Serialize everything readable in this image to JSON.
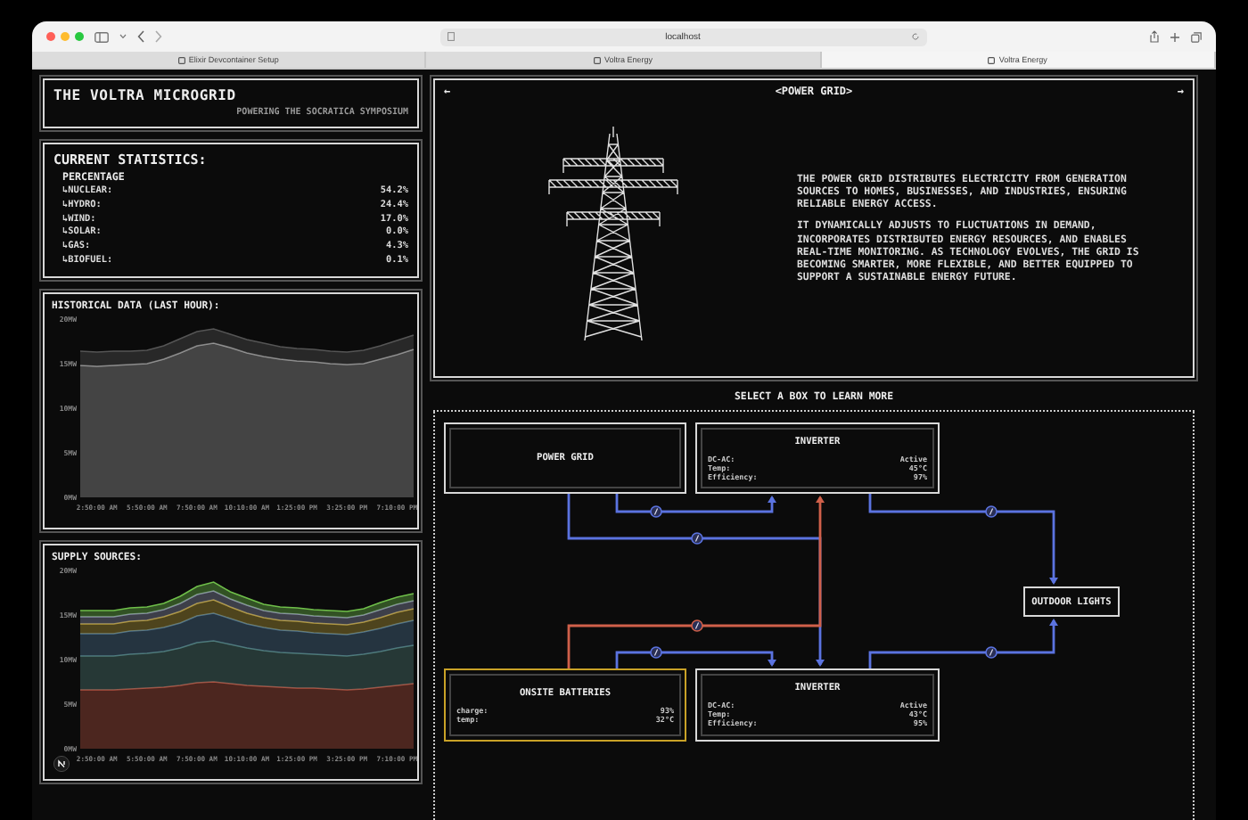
{
  "browser": {
    "address": "localhost",
    "tabs": [
      {
        "label": "Elixir Devcontainer Setup",
        "selected": false
      },
      {
        "label": "Voltra Energy",
        "selected": false
      },
      {
        "label": "Voltra Energy",
        "selected": true
      }
    ]
  },
  "header": {
    "title": "THE VOLTRA MICROGRID",
    "subtitle": "POWERING THE SOCRATICA SYMPOSIUM"
  },
  "statistics": {
    "title": "CURRENT STATISTICS:",
    "heading": "PERCENTAGE",
    "rows": [
      {
        "label": "↳NUCLEAR:",
        "value": "54.2%"
      },
      {
        "label": "↳HYDRO:",
        "value": "24.4%"
      },
      {
        "label": "↳WIND:",
        "value": "17.0%"
      },
      {
        "label": "↳SOLAR:",
        "value": "0.0%"
      },
      {
        "label": "↳GAS:",
        "value": "4.3%"
      },
      {
        "label": "↳BIOFUEL:",
        "value": "0.1%"
      }
    ]
  },
  "historical": {
    "title": "HISTORICAL DATA (LAST HOUR):",
    "chart_data": {
      "type": "area",
      "stacked": true,
      "categories": [
        null,
        "2:50:00 AM",
        null,
        null,
        "5:50:00 AM",
        null,
        null,
        "7:50:00 AM",
        null,
        null,
        "10:10:00 AM",
        null,
        null,
        "1:25:00 PM",
        null,
        null,
        "3:25:00 PM",
        null,
        null,
        "7:10:00 PM",
        null
      ],
      "ylim": [
        0,
        20
      ],
      "yticks": [
        {
          "value": 0,
          "label": "0MW"
        },
        {
          "value": 5,
          "label": "5MW"
        },
        {
          "value": 10,
          "label": "10MW"
        },
        {
          "value": 15,
          "label": "15MW"
        },
        {
          "value": 20,
          "label": "20MW"
        }
      ],
      "series": [
        {
          "color": "#9a9a9a",
          "values": [
            14.8,
            14.7,
            14.8,
            14.9,
            15.0,
            15.5,
            16.2,
            17.0,
            17.3,
            16.8,
            16.2,
            15.8,
            15.5,
            15.3,
            15.2,
            15.0,
            14.9,
            15.0,
            15.5,
            16.0,
            16.6
          ]
        },
        {
          "color": "#555555",
          "values": [
            1.6,
            1.6,
            1.6,
            1.5,
            1.5,
            1.5,
            1.6,
            1.6,
            1.6,
            1.5,
            1.5,
            1.5,
            1.4,
            1.4,
            1.4,
            1.4,
            1.4,
            1.5,
            1.5,
            1.6,
            1.6
          ]
        }
      ]
    }
  },
  "supply": {
    "title": "SUPPLY SOURCES:",
    "chart_data": {
      "type": "area",
      "stacked": true,
      "categories": [
        null,
        "2:50:00 AM",
        null,
        null,
        "5:50:00 AM",
        null,
        null,
        "7:50:00 AM",
        null,
        null,
        "10:10:00 AM",
        null,
        null,
        "1:25:00 PM",
        null,
        null,
        "3:25:00 PM",
        null,
        null,
        "7:10:00 PM",
        null
      ],
      "ylim": [
        0,
        20
      ],
      "yticks": [
        {
          "value": 0,
          "label": "0MW"
        },
        {
          "value": 5,
          "label": "5MW"
        },
        {
          "value": 10,
          "label": "10MW"
        },
        {
          "value": 15,
          "label": "15MW"
        },
        {
          "value": 20,
          "label": "20MW"
        }
      ],
      "series": [
        {
          "color": "#b0503f",
          "values": [
            6.6,
            6.6,
            6.6,
            6.7,
            6.8,
            6.9,
            7.1,
            7.4,
            7.5,
            7.3,
            7.1,
            7.0,
            6.9,
            6.8,
            6.8,
            6.7,
            6.6,
            6.7,
            6.9,
            7.1,
            7.3
          ]
        },
        {
          "color": "#4f7c78",
          "values": [
            3.8,
            3.8,
            3.8,
            3.9,
            3.9,
            4.0,
            4.2,
            4.5,
            4.6,
            4.4,
            4.2,
            4.0,
            3.9,
            3.9,
            3.8,
            3.8,
            3.8,
            3.9,
            4.0,
            4.2,
            4.3
          ]
        },
        {
          "color": "#4d7390",
          "values": [
            2.5,
            2.5,
            2.5,
            2.6,
            2.6,
            2.7,
            2.8,
            3.0,
            3.1,
            2.9,
            2.7,
            2.6,
            2.5,
            2.5,
            2.4,
            2.4,
            2.4,
            2.5,
            2.6,
            2.7,
            2.8
          ]
        },
        {
          "color": "#b59a3a",
          "values": [
            1.1,
            1.1,
            1.1,
            1.1,
            1.1,
            1.2,
            1.3,
            1.4,
            1.5,
            1.3,
            1.2,
            1.1,
            1.1,
            1.1,
            1.1,
            1.1,
            1.1,
            1.1,
            1.2,
            1.3,
            1.3
          ]
        },
        {
          "color": "#8a8fa8",
          "values": [
            0.8,
            0.8,
            0.8,
            0.8,
            0.8,
            0.8,
            0.9,
            1.0,
            1.0,
            0.9,
            0.9,
            0.8,
            0.8,
            0.8,
            0.8,
            0.8,
            0.8,
            0.8,
            0.9,
            0.9,
            0.9
          ]
        },
        {
          "color": "#6fbf4a",
          "values": [
            0.7,
            0.7,
            0.7,
            0.7,
            0.7,
            0.7,
            0.8,
            0.9,
            1.0,
            0.8,
            0.8,
            0.7,
            0.7,
            0.7,
            0.7,
            0.7,
            0.7,
            0.7,
            0.8,
            0.8,
            0.8
          ]
        }
      ]
    }
  },
  "info": {
    "prev": "←",
    "next": "→",
    "title": "<POWER GRID>",
    "paragraphs": [
      "THE POWER GRID DISTRIBUTES ELECTRICITY FROM GENERATION SOURCES TO HOMES, BUSINESSES, AND INDUSTRIES, ENSURING RELIABLE ENERGY ACCESS.",
      "IT DYNAMICALLY ADJUSTS TO FLUCTUATIONS IN DEMAND, INCORPORATES DISTRIBUTED ENERGY RESOURCES, AND ENABLES REAL-TIME MONITORING. AS TECHNOLOGY EVOLVES, THE GRID IS BECOMING SMARTER, MORE FLEXIBLE, AND BETTER EQUIPPED TO SUPPORT A SUSTAINABLE ENERGY FUTURE."
    ]
  },
  "diagram": {
    "prompt": "SELECT A BOX TO LEARN MORE",
    "nodes": [
      {
        "kind": "box",
        "title": "POWER GRID",
        "color": "#d8d8d8"
      },
      {
        "kind": "box",
        "title": "INVERTER",
        "color": "#d8d8d8",
        "fields": [
          {
            "label": "DC-AC:",
            "value": "Active"
          },
          {
            "label": "Temp:",
            "value": "45°C"
          },
          {
            "label": "Efficiency:",
            "value": "97%"
          }
        ]
      },
      {
        "kind": "tag",
        "title": "OUTDOOR LIGHTS",
        "color": "#d8d8d8"
      },
      {
        "kind": "box",
        "title": "ONSITE BATTERIES",
        "color": "#c9a227",
        "fields": [
          {
            "label": "charge:",
            "value": "93%"
          },
          {
            "label": "temp:",
            "value": "32°C"
          }
        ]
      },
      {
        "kind": "box",
        "title": "INVERTER",
        "color": "#d8d8d8",
        "fields": [
          {
            "label": "DC-AC:",
            "value": "Active"
          },
          {
            "label": "Temp:",
            "value": "43°C"
          },
          {
            "label": "Efficiency:",
            "value": "95%"
          }
        ]
      }
    ],
    "edges": [
      {
        "color": "#5b73e0"
      },
      {
        "color": "#5b73e0"
      },
      {
        "color": "#5b73e0"
      },
      {
        "color": "#d0604a"
      },
      {
        "color": "#5b73e0"
      },
      {
        "color": "#5b73e0"
      }
    ]
  }
}
